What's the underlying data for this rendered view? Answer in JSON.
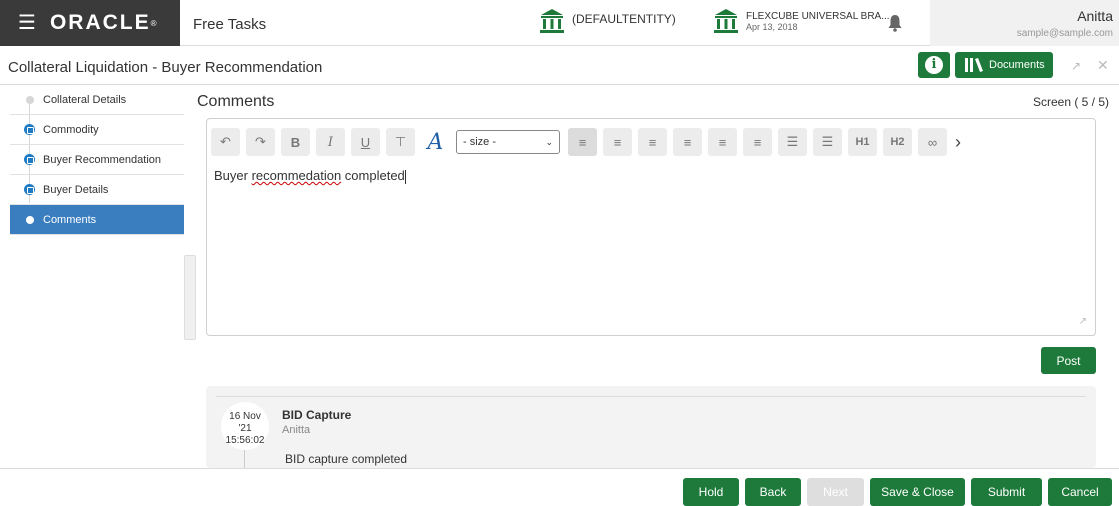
{
  "header": {
    "menu_icon": "hamburger-icon",
    "logo": "ORACLE",
    "app_name": "Free Tasks",
    "entity": "(DEFAULTENTITY)",
    "branch": "FLEXCUBE UNIVERSAL BRA...",
    "branch_date": "Apr 13, 2018",
    "user_name": "Anitta",
    "user_email": "sample@sample.com"
  },
  "titlebar": {
    "title": "Collateral Liquidation - Buyer Recommendation",
    "documents_label": "Documents"
  },
  "sidebar": {
    "items": [
      {
        "label": "Collateral Details",
        "state": "pending"
      },
      {
        "label": "Commodity",
        "state": "visited"
      },
      {
        "label": "Buyer Recommendation",
        "state": "visited"
      },
      {
        "label": "Buyer Details",
        "state": "visited"
      },
      {
        "label": "Comments",
        "state": "active"
      }
    ]
  },
  "main": {
    "section_title": "Comments",
    "screen_count": "Screen ( 5 / 5)",
    "editor": {
      "size_select": "- size -",
      "h1": "H1",
      "h2": "H2",
      "text_before": "Buyer ",
      "text_misspelled": "recommedation",
      "text_after": " completed"
    },
    "post_label": "Post",
    "history": {
      "date_line1": "16 Nov",
      "date_line2": "'21",
      "date_line3": "15:56:02",
      "title": "BID Capture",
      "user": "Anitta",
      "text": "BID capture completed"
    }
  },
  "footer": {
    "hold": "Hold",
    "back": "Back",
    "next": "Next",
    "save_close": "Save & Close",
    "submit": "Submit",
    "cancel": "Cancel"
  },
  "colors": {
    "brand_dark": "#3a3a3a",
    "accent_green": "#1d7a3a",
    "active_blue": "#3a7ebf",
    "step_blue": "#1f7bc4"
  }
}
